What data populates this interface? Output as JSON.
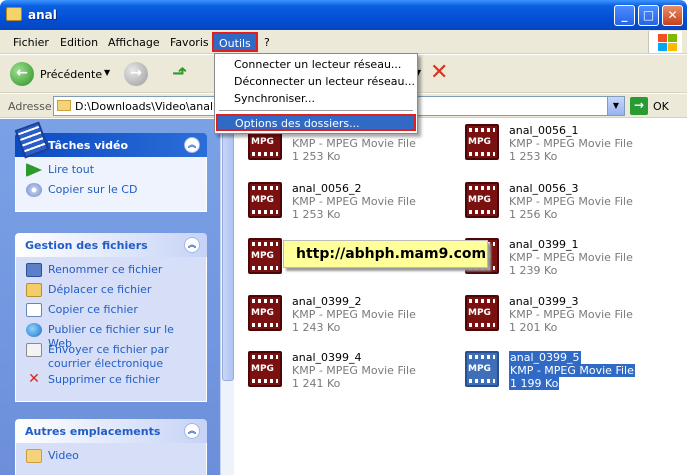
{
  "window": {
    "title": "anal",
    "minimize": "_",
    "maximize": "□",
    "close": "✕"
  },
  "menubar": {
    "items": [
      "Fichier",
      "Edition",
      "Affichage",
      "Favoris",
      "Outils",
      "?"
    ]
  },
  "toolbar": {
    "back_label": "Précédente",
    "arrow": "▼"
  },
  "address": {
    "label": "Adresse",
    "value": "D:\\Downloads\\Video\\anal",
    "go_label": "OK"
  },
  "tools_menu": {
    "items": [
      "Connecter un lecteur réseau...",
      "Déconnecter un lecteur réseau...",
      "Synchroniser...",
      "Options des dossiers..."
    ]
  },
  "left_panels": {
    "video": {
      "title": "Tâches vidéo",
      "tasks": [
        "Lire tout",
        "Copier sur le CD"
      ]
    },
    "files": {
      "title": "Gestion des fichiers",
      "tasks": [
        "Renommer ce fichier",
        "Déplacer ce fichier",
        "Copier ce fichier",
        "Publier ce fichier sur le Web",
        "Envoyer ce fichier par courrier électronique",
        "Supprimer ce fichier"
      ]
    },
    "places": {
      "title": "Autres emplacements",
      "tasks": [
        "Video"
      ]
    }
  },
  "files": [
    {
      "name": "anal_0056_1",
      "type": "KMP - MPEG Movie File",
      "size": "1 253 Ko"
    },
    {
      "name": "anal_0056_2",
      "type": "KMP - MPEG Movie File",
      "size": "1 253 Ko"
    },
    {
      "name": "anal_0056_3",
      "type": "KMP - MPEG Movie File",
      "size": "1 256 Ko"
    },
    {
      "name": "anal_0399_1",
      "type": "KMP - MPEG Movie File",
      "size": "1 239 Ko"
    },
    {
      "name": "anal_0399_2",
      "type": "KMP - MPEG Movie File",
      "size": "1 243 Ko"
    },
    {
      "name": "anal_0399_3",
      "type": "KMP - MPEG Movie File",
      "size": "1 201 Ko"
    },
    {
      "name": "anal_0399_4",
      "type": "KMP - MPEG Movie File",
      "size": "1 241 Ko"
    },
    {
      "name": "anal_0399_5",
      "type": "KMP - MPEG Movie File",
      "size": "1 199 Ko"
    }
  ],
  "partial_file": {
    "type": "KMP - MPEG Movie File",
    "size": "1 253 Ko"
  },
  "icon_label": "MPG",
  "watermark": "http://abhph.mam9.com"
}
